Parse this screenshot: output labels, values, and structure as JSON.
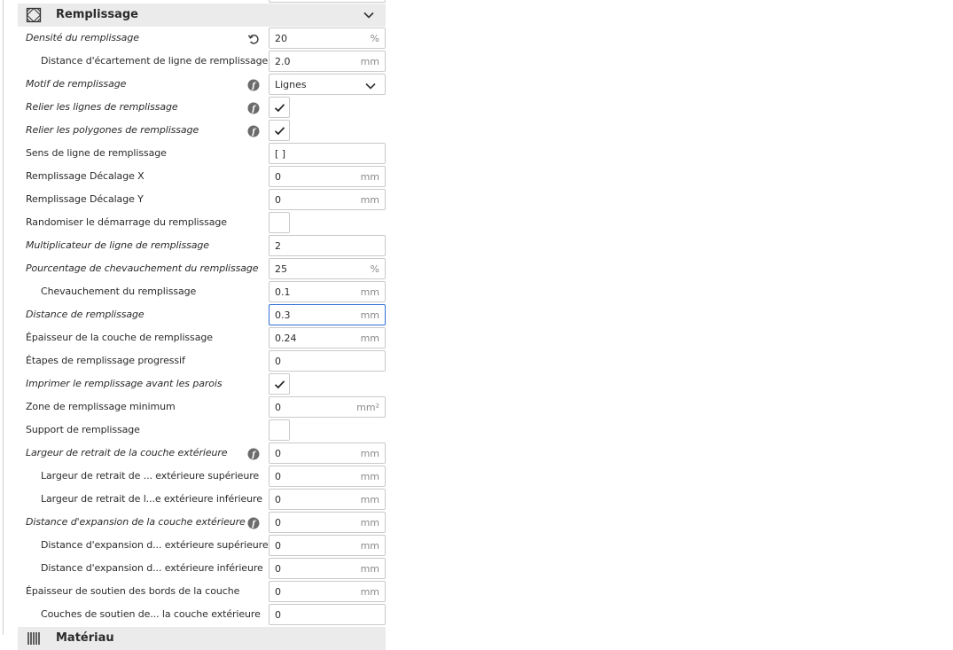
{
  "infill_section": {
    "title": "Remplissage",
    "icon": "infill-pattern-icon",
    "collapse_icon": "chevron-down-icon"
  },
  "settings": [
    {
      "key": "infill_density",
      "label": "Densité du remplissage",
      "italic": true,
      "indent": 1,
      "indicator": "reset-icon",
      "control": "text",
      "value": "20",
      "unit": "%"
    },
    {
      "key": "infill_line_distance",
      "label": "Distance d'écartement de ligne de remplissage",
      "italic": false,
      "indent": 2,
      "indicator": null,
      "control": "text",
      "value": "2.0",
      "unit": "mm"
    },
    {
      "key": "infill_pattern",
      "label": "Motif de remplissage",
      "italic": true,
      "indent": 1,
      "indicator": "function-icon",
      "control": "dropdown",
      "value": "Lignes",
      "unit": ""
    },
    {
      "key": "zig_zaggify_infill",
      "label": "Relier les lignes de remplissage",
      "italic": true,
      "indent": 1,
      "indicator": "function-icon",
      "control": "checkbox",
      "checked": true
    },
    {
      "key": "connect_infill_polygons",
      "label": "Relier les polygones de remplissage",
      "italic": true,
      "indent": 1,
      "indicator": "function-icon",
      "control": "checkbox",
      "checked": true
    },
    {
      "key": "infill_angles",
      "label": "Sens de ligne de remplissage",
      "italic": false,
      "indent": 1,
      "indicator": null,
      "control": "text",
      "value": "[ ]",
      "unit": ""
    },
    {
      "key": "infill_offset_x",
      "label": "Remplissage Décalage X",
      "italic": false,
      "indent": 1,
      "indicator": null,
      "control": "text",
      "value": "0",
      "unit": "mm"
    },
    {
      "key": "infill_offset_y",
      "label": "Remplissage Décalage Y",
      "italic": false,
      "indent": 1,
      "indicator": null,
      "control": "text",
      "value": "0",
      "unit": "mm"
    },
    {
      "key": "infill_randomize_start",
      "label": "Randomiser le démarrage du remplissage",
      "italic": false,
      "indent": 1,
      "indicator": null,
      "control": "checkbox",
      "checked": false
    },
    {
      "key": "infill_multiplier",
      "label": "Multiplicateur de ligne de remplissage",
      "italic": true,
      "indent": 1,
      "indicator": null,
      "control": "text",
      "value": "2",
      "unit": ""
    },
    {
      "key": "infill_overlap",
      "label": "Pourcentage de chevauchement du remplissage",
      "italic": true,
      "indent": 1,
      "indicator": null,
      "control": "text",
      "value": "25",
      "unit": "%"
    },
    {
      "key": "infill_overlap_mm",
      "label": "Chevauchement du remplissage",
      "italic": false,
      "indent": 2,
      "indicator": null,
      "control": "text",
      "value": "0.1",
      "unit": "mm"
    },
    {
      "key": "infill_wipe_dist",
      "label": "Distance de remplissage",
      "italic": true,
      "indent": 1,
      "indicator": null,
      "control": "text",
      "value": "0.3",
      "unit": "mm",
      "focused": true
    },
    {
      "key": "infill_sparse_thickness",
      "label": "Épaisseur de la couche de remplissage",
      "italic": false,
      "indent": 1,
      "indicator": null,
      "control": "text",
      "value": "0.24",
      "unit": "mm"
    },
    {
      "key": "gradual_infill_steps",
      "label": "Étapes de remplissage progressif",
      "italic": false,
      "indent": 1,
      "indicator": null,
      "control": "text",
      "value": "0",
      "unit": ""
    },
    {
      "key": "infill_before_walls",
      "label": "Imprimer le remplissage avant les parois",
      "italic": true,
      "indent": 1,
      "indicator": null,
      "control": "checkbox",
      "checked": true
    },
    {
      "key": "min_infill_area",
      "label": "Zone de remplissage minimum",
      "italic": false,
      "indent": 1,
      "indicator": null,
      "control": "text",
      "value": "0",
      "unit": "mm²"
    },
    {
      "key": "infill_support_enabled",
      "label": "Support de remplissage",
      "italic": false,
      "indent": 1,
      "indicator": null,
      "control": "checkbox",
      "checked": false
    },
    {
      "key": "skin_preshrink",
      "label": "Largeur de retrait de la couche extérieure",
      "italic": true,
      "indent": 1,
      "indicator": "function-icon",
      "control": "text",
      "value": "0",
      "unit": "mm"
    },
    {
      "key": "top_skin_preshrink",
      "label": "Largeur de retrait de ... extérieure supérieure",
      "italic": false,
      "indent": 2,
      "indicator": null,
      "control": "text",
      "value": "0",
      "unit": "mm"
    },
    {
      "key": "bottom_skin_preshrink",
      "label": "Largeur de retrait de l...e extérieure inférieure",
      "italic": false,
      "indent": 2,
      "indicator": null,
      "control": "text",
      "value": "0",
      "unit": "mm"
    },
    {
      "key": "expand_skins_expand_distance",
      "label": "Distance d'expansion de la couche extérieure",
      "italic": true,
      "indent": 1,
      "indicator": "function-icon",
      "control": "text",
      "value": "0",
      "unit": "mm"
    },
    {
      "key": "top_skin_expand_distance",
      "label": "Distance d'expansion d... extérieure supérieure",
      "italic": false,
      "indent": 2,
      "indicator": null,
      "control": "text",
      "value": "0",
      "unit": "mm"
    },
    {
      "key": "bottom_skin_expand_distance",
      "label": "Distance d'expansion d... extérieure inférieure",
      "italic": false,
      "indent": 2,
      "indicator": null,
      "control": "text",
      "value": "0",
      "unit": "mm"
    },
    {
      "key": "skin_edge_support_thickness",
      "label": "Épaisseur de soutien des bords de la couche",
      "italic": false,
      "indent": 1,
      "indicator": null,
      "control": "text",
      "value": "0",
      "unit": "mm"
    },
    {
      "key": "skin_edge_support_layers",
      "label": "Couches de soutien de... la couche extérieure",
      "italic": false,
      "indent": 2,
      "indicator": null,
      "control": "text",
      "value": "0",
      "unit": ""
    }
  ],
  "next_section": {
    "title": "Matériau",
    "icon": "material-spool-icon"
  }
}
